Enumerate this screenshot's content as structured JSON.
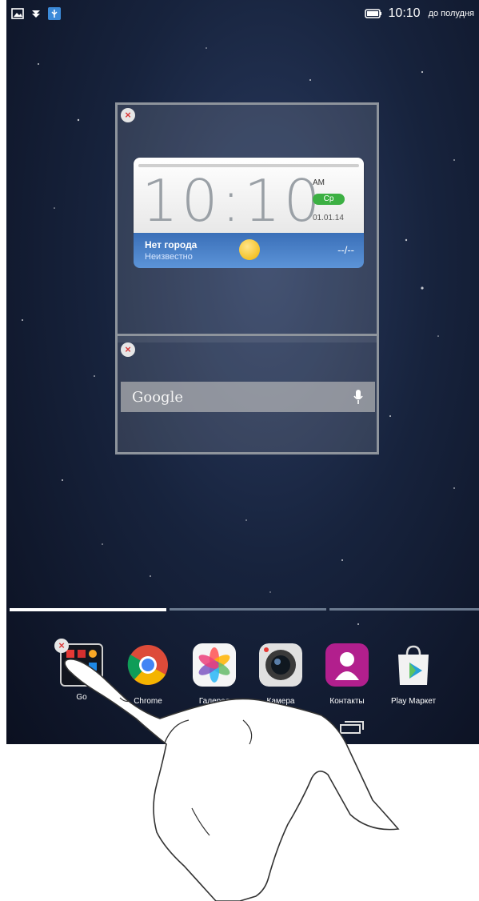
{
  "status_bar": {
    "icons": [
      "image-icon",
      "download-icon",
      "usb-icon"
    ],
    "battery_icon": "battery-icon",
    "time": "10:10",
    "ampm": "до полудня"
  },
  "edit_panel": {
    "clock_widget": {
      "time": "10:10",
      "ampm": "AM",
      "day": "Ср",
      "date": "01.01.14",
      "city": "Нет города",
      "city_sub": "Неизвестно",
      "temperature": "--/--",
      "day_badge_color": "#3cb043"
    },
    "search_widget": {
      "logo": "Google",
      "mic_icon": "microphone-icon"
    }
  },
  "dock": {
    "apps": [
      {
        "label": "Go",
        "icon": "folder-icon"
      },
      {
        "label": "Chrome",
        "icon": "chrome-icon"
      },
      {
        "label": "Галерея",
        "icon": "gallery-icon"
      },
      {
        "label": "Камера",
        "icon": "camera-icon"
      },
      {
        "label": "Контакты",
        "icon": "contacts-icon"
      },
      {
        "label": "Play Маркет",
        "icon": "play-store-icon"
      }
    ]
  },
  "navigation": {
    "up_icon": "chevron-up-icon",
    "recent_icon": "recent-apps-icon"
  }
}
